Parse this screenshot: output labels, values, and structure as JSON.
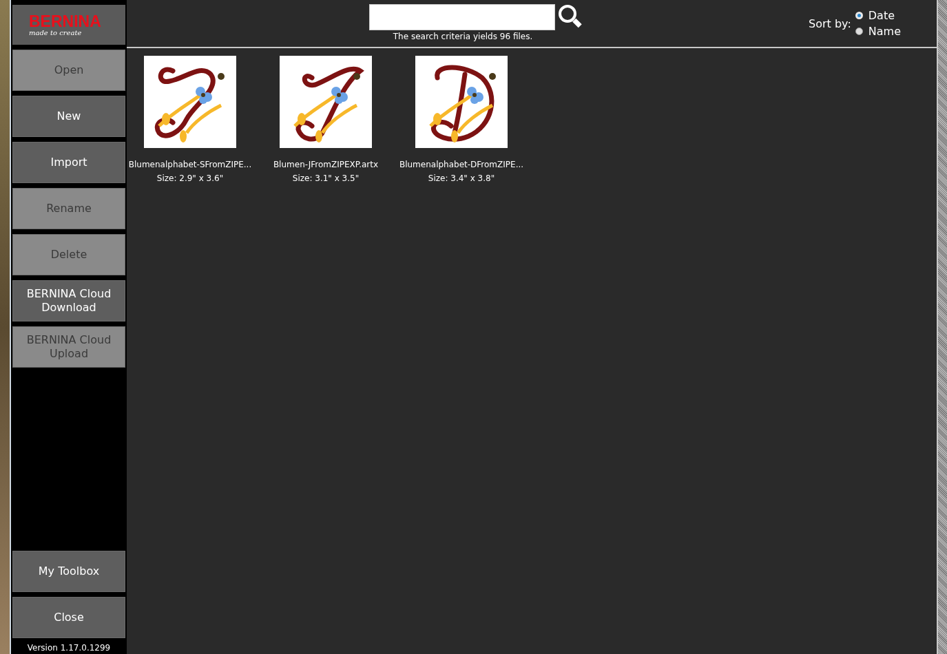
{
  "logo": {
    "brand": "BERNINA",
    "tagline": "made to create"
  },
  "sidebar": {
    "buttons": [
      {
        "label": "Open",
        "disabled": true
      },
      {
        "label": "New",
        "disabled": false
      },
      {
        "label": "Import",
        "disabled": false
      },
      {
        "label": "Rename",
        "disabled": true
      },
      {
        "label": "Delete",
        "disabled": true
      },
      {
        "label": "BERNINA Cloud Download",
        "disabled": false
      },
      {
        "label": "BERNINA Cloud Upload",
        "disabled": true
      }
    ],
    "bottom_buttons": [
      {
        "label": "My Toolbox",
        "disabled": false
      },
      {
        "label": "Close",
        "disabled": false
      }
    ],
    "version": "Version 1.17.0.1299"
  },
  "search": {
    "status": "The search criteria yields 96 files."
  },
  "sort": {
    "label": "Sort by:",
    "options": [
      {
        "label": "Date",
        "selected": true
      },
      {
        "label": "Name",
        "selected": false
      }
    ]
  },
  "files": [
    {
      "name": "Blumenalphabet-SFromZIPE...",
      "size": "Size: 2.9\" x 3.6\""
    },
    {
      "name": "Blumen-JFromZIPEXP.artx",
      "size": "Size: 3.1\" x 3.5\""
    },
    {
      "name": "Blumenalphabet-DFromZIPE...",
      "size": "Size: 3.4\" x 3.8\""
    }
  ]
}
